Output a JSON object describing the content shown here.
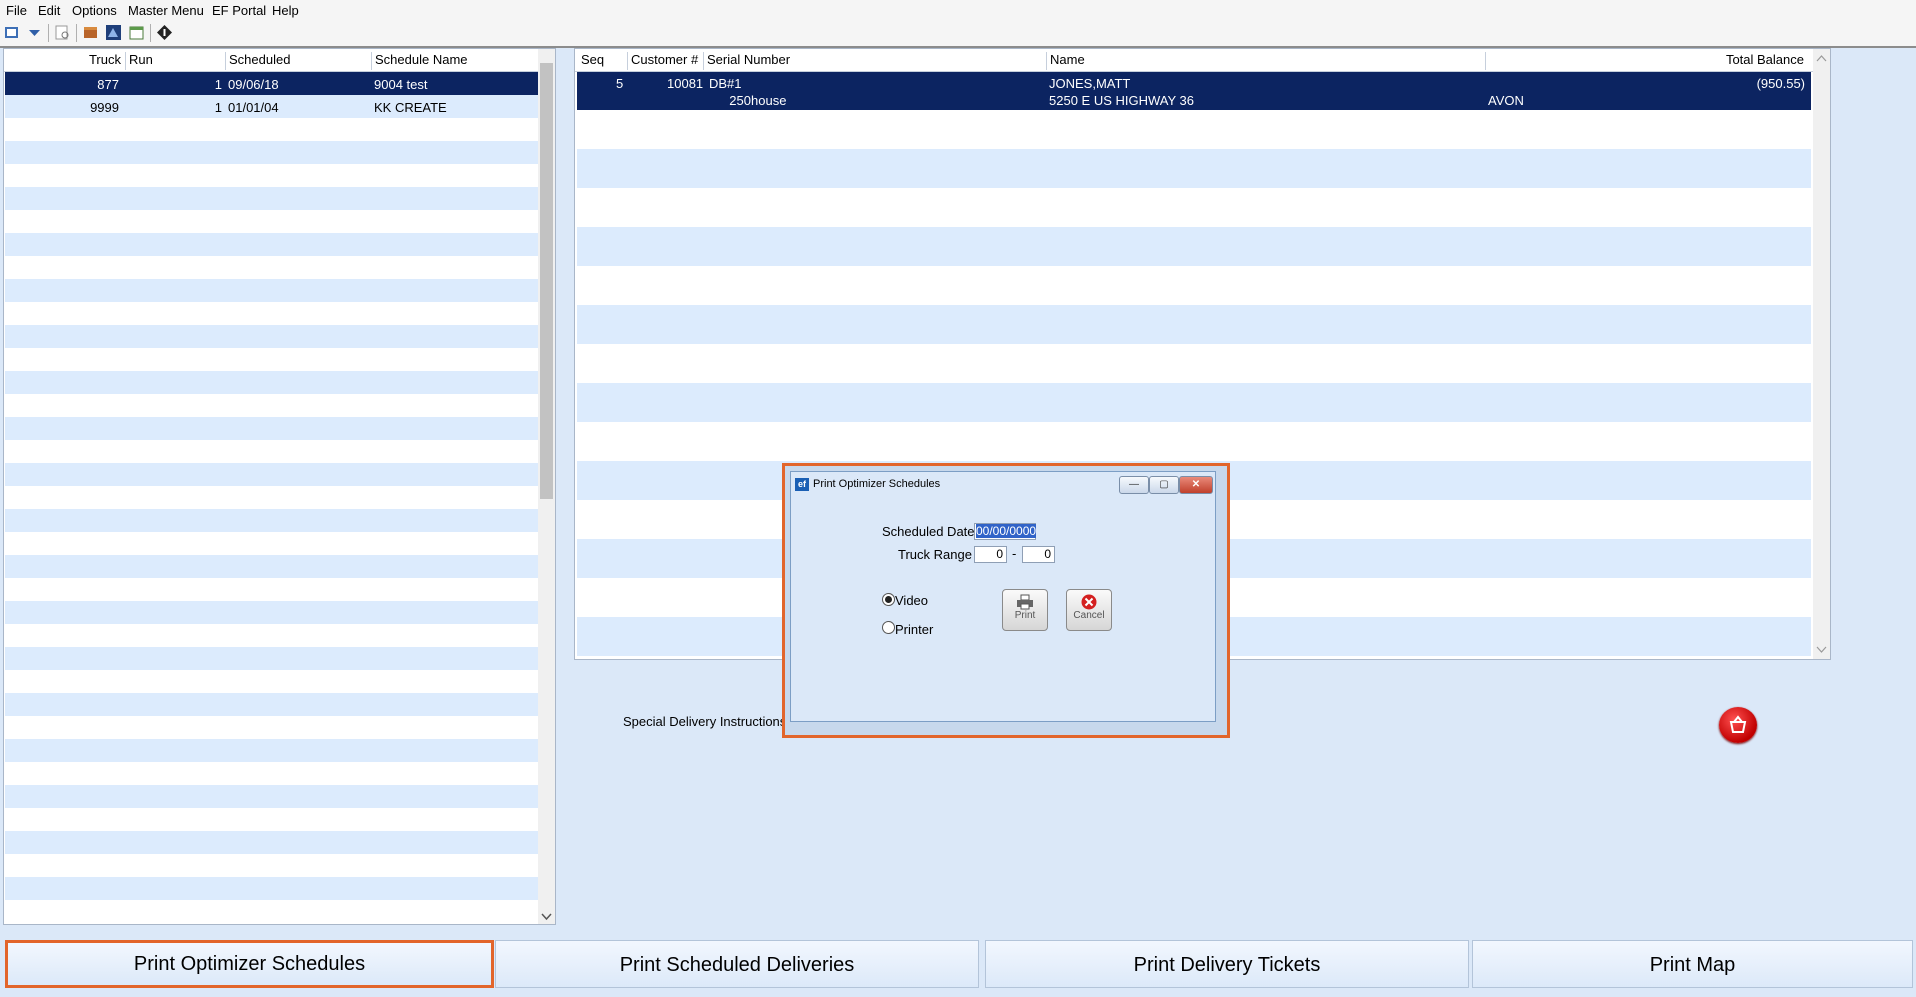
{
  "menu": [
    "File",
    "Edit",
    "Options",
    "Master Menu",
    "EF Portal",
    "Help"
  ],
  "left_grid": {
    "columns": [
      "Truck",
      "Run",
      "Scheduled",
      "Schedule Name"
    ],
    "rows": [
      {
        "truck": "877",
        "run": "1",
        "scheduled": "09/06/18",
        "name": "9004 test"
      },
      {
        "truck": "9999",
        "run": "1",
        "scheduled": "01/01/04",
        "name": "KK CREATE"
      }
    ]
  },
  "right_grid": {
    "columns": [
      "Seq",
      "Customer #",
      "Serial Number",
      "Name",
      "Total Balance"
    ],
    "rows": [
      {
        "seq": "5",
        "customer": "10081",
        "serial": "DB#1",
        "serial2": "250",
        "serial3": "house",
        "name": "JONES,MATT",
        "address": "5250 E US HIGHWAY 36",
        "city": "AVON",
        "balance": "(950.55)"
      }
    ]
  },
  "special_instructions_label": "Special Delivery Instructions",
  "dialog": {
    "title": "Print Optimizer Schedules",
    "scheduled_date_label": "Scheduled Date",
    "scheduled_date_value": "00/00/0000",
    "truck_range_label": "Truck Range",
    "truck_from": "0",
    "truck_sep": "-",
    "truck_to": "0",
    "radio_video": "Video",
    "radio_printer": "Printer",
    "selected_output": "Video",
    "print_label": "Print",
    "cancel_label": "Cancel"
  },
  "bottom_buttons": [
    "Print Optimizer Schedules",
    "Print Scheduled Deliveries",
    "Print Delivery Tickets",
    "Print Map"
  ],
  "colors": {
    "selection": "#0c2461",
    "highlight_border": "#e2652b",
    "band": "#dcebfd"
  }
}
